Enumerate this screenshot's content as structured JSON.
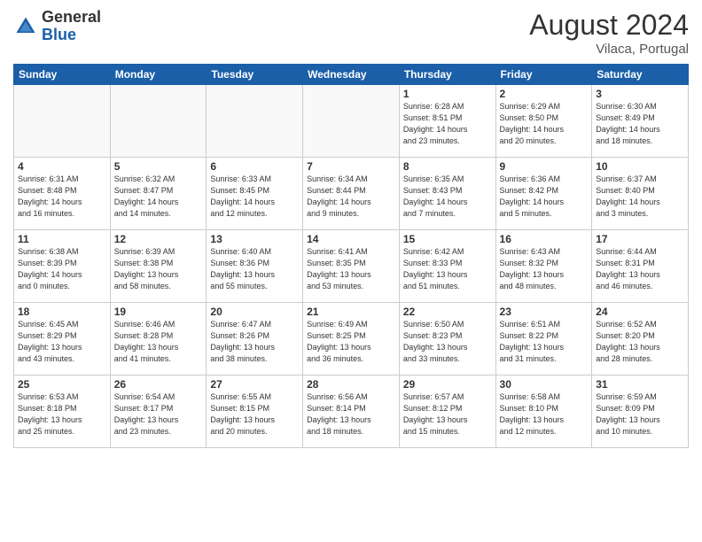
{
  "header": {
    "logo_general": "General",
    "logo_blue": "Blue",
    "month_year": "August 2024",
    "location": "Vilaca, Portugal"
  },
  "weekdays": [
    "Sunday",
    "Monday",
    "Tuesday",
    "Wednesday",
    "Thursday",
    "Friday",
    "Saturday"
  ],
  "weeks": [
    [
      {
        "day": "",
        "info": ""
      },
      {
        "day": "",
        "info": ""
      },
      {
        "day": "",
        "info": ""
      },
      {
        "day": "",
        "info": ""
      },
      {
        "day": "1",
        "info": "Sunrise: 6:28 AM\nSunset: 8:51 PM\nDaylight: 14 hours\nand 23 minutes."
      },
      {
        "day": "2",
        "info": "Sunrise: 6:29 AM\nSunset: 8:50 PM\nDaylight: 14 hours\nand 20 minutes."
      },
      {
        "day": "3",
        "info": "Sunrise: 6:30 AM\nSunset: 8:49 PM\nDaylight: 14 hours\nand 18 minutes."
      }
    ],
    [
      {
        "day": "4",
        "info": "Sunrise: 6:31 AM\nSunset: 8:48 PM\nDaylight: 14 hours\nand 16 minutes."
      },
      {
        "day": "5",
        "info": "Sunrise: 6:32 AM\nSunset: 8:47 PM\nDaylight: 14 hours\nand 14 minutes."
      },
      {
        "day": "6",
        "info": "Sunrise: 6:33 AM\nSunset: 8:45 PM\nDaylight: 14 hours\nand 12 minutes."
      },
      {
        "day": "7",
        "info": "Sunrise: 6:34 AM\nSunset: 8:44 PM\nDaylight: 14 hours\nand 9 minutes."
      },
      {
        "day": "8",
        "info": "Sunrise: 6:35 AM\nSunset: 8:43 PM\nDaylight: 14 hours\nand 7 minutes."
      },
      {
        "day": "9",
        "info": "Sunrise: 6:36 AM\nSunset: 8:42 PM\nDaylight: 14 hours\nand 5 minutes."
      },
      {
        "day": "10",
        "info": "Sunrise: 6:37 AM\nSunset: 8:40 PM\nDaylight: 14 hours\nand 3 minutes."
      }
    ],
    [
      {
        "day": "11",
        "info": "Sunrise: 6:38 AM\nSunset: 8:39 PM\nDaylight: 14 hours\nand 0 minutes."
      },
      {
        "day": "12",
        "info": "Sunrise: 6:39 AM\nSunset: 8:38 PM\nDaylight: 13 hours\nand 58 minutes."
      },
      {
        "day": "13",
        "info": "Sunrise: 6:40 AM\nSunset: 8:36 PM\nDaylight: 13 hours\nand 55 minutes."
      },
      {
        "day": "14",
        "info": "Sunrise: 6:41 AM\nSunset: 8:35 PM\nDaylight: 13 hours\nand 53 minutes."
      },
      {
        "day": "15",
        "info": "Sunrise: 6:42 AM\nSunset: 8:33 PM\nDaylight: 13 hours\nand 51 minutes."
      },
      {
        "day": "16",
        "info": "Sunrise: 6:43 AM\nSunset: 8:32 PM\nDaylight: 13 hours\nand 48 minutes."
      },
      {
        "day": "17",
        "info": "Sunrise: 6:44 AM\nSunset: 8:31 PM\nDaylight: 13 hours\nand 46 minutes."
      }
    ],
    [
      {
        "day": "18",
        "info": "Sunrise: 6:45 AM\nSunset: 8:29 PM\nDaylight: 13 hours\nand 43 minutes."
      },
      {
        "day": "19",
        "info": "Sunrise: 6:46 AM\nSunset: 8:28 PM\nDaylight: 13 hours\nand 41 minutes."
      },
      {
        "day": "20",
        "info": "Sunrise: 6:47 AM\nSunset: 8:26 PM\nDaylight: 13 hours\nand 38 minutes."
      },
      {
        "day": "21",
        "info": "Sunrise: 6:49 AM\nSunset: 8:25 PM\nDaylight: 13 hours\nand 36 minutes."
      },
      {
        "day": "22",
        "info": "Sunrise: 6:50 AM\nSunset: 8:23 PM\nDaylight: 13 hours\nand 33 minutes."
      },
      {
        "day": "23",
        "info": "Sunrise: 6:51 AM\nSunset: 8:22 PM\nDaylight: 13 hours\nand 31 minutes."
      },
      {
        "day": "24",
        "info": "Sunrise: 6:52 AM\nSunset: 8:20 PM\nDaylight: 13 hours\nand 28 minutes."
      }
    ],
    [
      {
        "day": "25",
        "info": "Sunrise: 6:53 AM\nSunset: 8:18 PM\nDaylight: 13 hours\nand 25 minutes."
      },
      {
        "day": "26",
        "info": "Sunrise: 6:54 AM\nSunset: 8:17 PM\nDaylight: 13 hours\nand 23 minutes."
      },
      {
        "day": "27",
        "info": "Sunrise: 6:55 AM\nSunset: 8:15 PM\nDaylight: 13 hours\nand 20 minutes."
      },
      {
        "day": "28",
        "info": "Sunrise: 6:56 AM\nSunset: 8:14 PM\nDaylight: 13 hours\nand 18 minutes."
      },
      {
        "day": "29",
        "info": "Sunrise: 6:57 AM\nSunset: 8:12 PM\nDaylight: 13 hours\nand 15 minutes."
      },
      {
        "day": "30",
        "info": "Sunrise: 6:58 AM\nSunset: 8:10 PM\nDaylight: 13 hours\nand 12 minutes."
      },
      {
        "day": "31",
        "info": "Sunrise: 6:59 AM\nSunset: 8:09 PM\nDaylight: 13 hours\nand 10 minutes."
      }
    ]
  ]
}
